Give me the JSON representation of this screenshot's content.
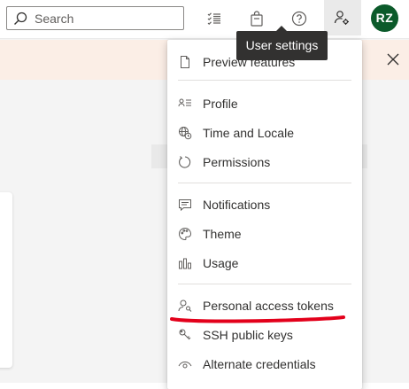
{
  "header": {
    "search_placeholder": "Search",
    "avatar_initials": "RZ",
    "icons": [
      "search-icon",
      "task-list-icon",
      "shopping-bag-icon",
      "help-icon",
      "user-settings-icon"
    ]
  },
  "tooltip": {
    "text": "User settings"
  },
  "menu": {
    "items": [
      {
        "label": "Preview features",
        "icon": "preview-page-icon"
      },
      {
        "label": "Profile",
        "icon": "profile-icon"
      },
      {
        "label": "Time and Locale",
        "icon": "globe-clock-icon"
      },
      {
        "label": "Permissions",
        "icon": "permissions-icon"
      },
      {
        "label": "Notifications",
        "icon": "chat-message-icon"
      },
      {
        "label": "Theme",
        "icon": "palette-icon"
      },
      {
        "label": "Usage",
        "icon": "bar-chart-icon"
      },
      {
        "label": "Personal access tokens",
        "icon": "key-user-icon"
      },
      {
        "label": "SSH public keys",
        "icon": "key-pair-icon"
      },
      {
        "label": "Alternate credentials",
        "icon": "eye-icon"
      }
    ]
  },
  "colors": {
    "avatar_bg": "#0b5a2a",
    "tooltip_bg": "#323130",
    "banner_bg": "#fbeee6",
    "annotation_red": "#e3001b"
  }
}
